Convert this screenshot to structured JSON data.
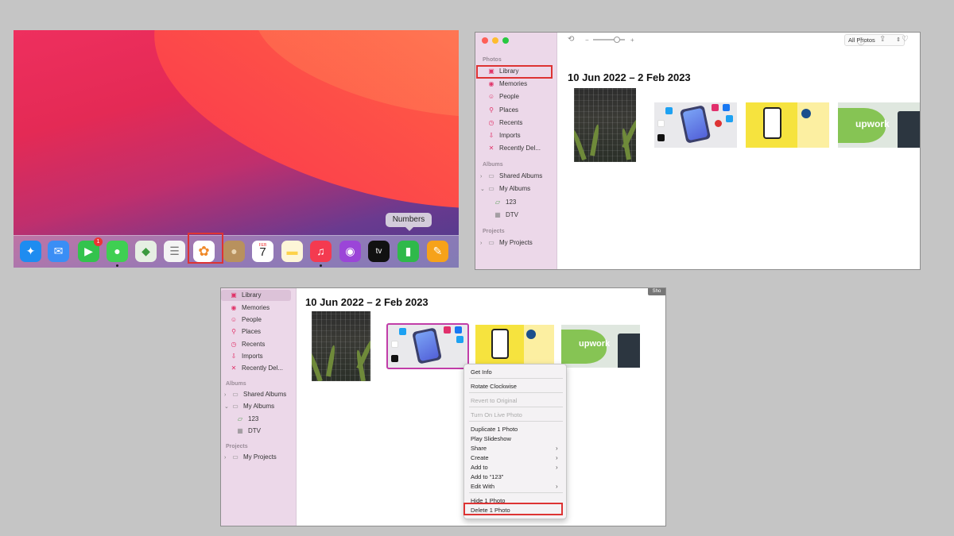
{
  "panel1": {
    "tooltip": "Numbers",
    "dock_icons": [
      {
        "name": "safari-icon",
        "glyph": "✦",
        "color": "#1e8cf0"
      },
      {
        "name": "mail-icon",
        "glyph": "✉",
        "color": "#3a8ef5"
      },
      {
        "name": "facetime-icon",
        "glyph": "▶",
        "color": "#33c34d",
        "badge": "1"
      },
      {
        "name": "messages-icon",
        "glyph": "●",
        "color": "#3fcf52"
      },
      {
        "name": "maps-icon",
        "glyph": "◆",
        "color": "#6fc06b"
      },
      {
        "name": "reminders-icon",
        "glyph": "☰",
        "color": "#f4f4f4"
      },
      {
        "name": "photos-icon",
        "glyph": "✿",
        "color": "#ffffff"
      },
      {
        "name": "contacts-icon",
        "glyph": "●",
        "color": "#b8915e"
      },
      {
        "name": "calendar-icon",
        "glyph": "7",
        "color": "#ffffff",
        "month": "FEB"
      },
      {
        "name": "notes-icon",
        "glyph": "▬",
        "color": "#fdd24a"
      },
      {
        "name": "music-icon",
        "glyph": "♫",
        "color": "#f43a50"
      },
      {
        "name": "podcasts-icon",
        "glyph": "◉",
        "color": "#9b45d8"
      },
      {
        "name": "apple-tv-icon",
        "glyph": "tv",
        "color": "#111111"
      },
      {
        "name": "numbers-icon",
        "glyph": "▮",
        "color": "#2fb94a"
      },
      {
        "name": "pages-icon",
        "glyph": "✎",
        "color": "#f6a21a"
      }
    ]
  },
  "panel2": {
    "view_selector": "All Photos",
    "date_range": "10 Jun 2022 – 2 Feb 2023",
    "sidebar": {
      "photos_header": "Photos",
      "albums_header": "Albums",
      "projects_header": "Projects",
      "items": [
        {
          "label": "Library",
          "icon": "▣"
        },
        {
          "label": "Memories",
          "icon": "◉"
        },
        {
          "label": "People",
          "icon": "☺"
        },
        {
          "label": "Places",
          "icon": "⚲"
        },
        {
          "label": "Recents",
          "icon": "◷"
        },
        {
          "label": "Imports",
          "icon": "⇩"
        },
        {
          "label": "Recently Del...",
          "icon": "🗑"
        }
      ],
      "albums": [
        {
          "label": "Shared Albums",
          "icon": "▭"
        },
        {
          "label": "My Albums",
          "icon": "▭"
        },
        {
          "label": "123",
          "icon": "▱"
        },
        {
          "label": "DTV",
          "icon": "▦"
        }
      ],
      "projects": [
        {
          "label": "My Projects",
          "icon": "▭"
        }
      ]
    }
  },
  "panel3": {
    "date_range": "10 Jun 2022 – 2 Feb 2023",
    "corner_label": "Sho",
    "context_menu": [
      {
        "label": "Get Info",
        "enabled": true
      },
      {
        "label": "Rotate Clockwise",
        "enabled": true
      },
      {
        "label": "Revert to Original",
        "enabled": false
      },
      {
        "label": "Turn On Live Photo",
        "enabled": false
      },
      {
        "label": "Duplicate 1 Photo",
        "enabled": true
      },
      {
        "label": "Play Slideshow",
        "enabled": true
      },
      {
        "label": "Share",
        "enabled": true,
        "submenu": true
      },
      {
        "label": "Create",
        "enabled": true,
        "submenu": true
      },
      {
        "label": "Add to",
        "enabled": true,
        "submenu": true
      },
      {
        "label": "Add to “123”",
        "enabled": true
      },
      {
        "label": "Edit With",
        "enabled": true,
        "submenu": true
      },
      {
        "label": "Hide 1 Photo",
        "enabled": true
      },
      {
        "label": "Delete 1 Photo",
        "enabled": true
      }
    ],
    "upwork_text": "upwork"
  },
  "colors": {
    "highlight_box": "#dd3333",
    "sidebar_bg": "#ecd8e9",
    "accent_pink": "#e0356a"
  }
}
